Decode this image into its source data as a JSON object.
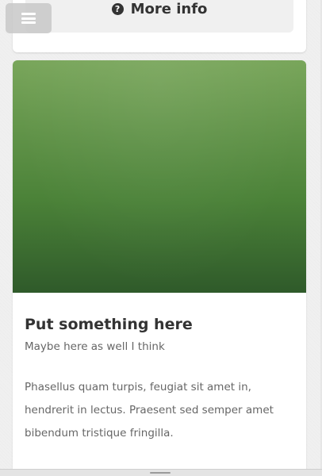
{
  "menu": {
    "icon": "hamburger-menu-icon"
  },
  "more_info": {
    "icon": "question-circle-icon",
    "icon_glyph": "?",
    "label": "More info"
  },
  "card": {
    "image_colors": [
      "#79a65b",
      "#4b8238",
      "#2f5a2a"
    ],
    "title": "Put something here",
    "subtitle": "Maybe here as well I think",
    "text": "Phasellus quam turpis, feugiat sit amet in, hendrerit in lectus. Praesent sed semper amet bibendum tristique fringilla."
  }
}
